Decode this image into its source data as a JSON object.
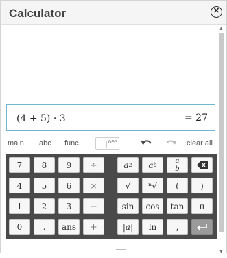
{
  "window": {
    "title": "Calculator",
    "close_symbol": "⊗"
  },
  "input": {
    "expression": "(4 + 5) · 3",
    "result": "= 27"
  },
  "toolbar": {
    "tabs": [
      "main",
      "abc",
      "func"
    ],
    "angle_mode": "DEG",
    "clear_label": "clear all"
  },
  "keypad": {
    "numeric": [
      [
        "7",
        "8",
        "9",
        "÷"
      ],
      [
        "4",
        "5",
        "6",
        "×"
      ],
      [
        "1",
        "2",
        "3",
        "−"
      ],
      [
        "0",
        ".",
        "ans",
        "+"
      ]
    ],
    "functions": [
      [
        "a²",
        "aᵇ",
        "a/b",
        "⌫"
      ],
      [
        "√",
        "ⁿ√",
        "(",
        ")"
      ],
      [
        "sin",
        "cos",
        "tan",
        "π"
      ],
      [
        "|a|",
        "ln",
        ",",
        "↵"
      ]
    ]
  },
  "colors": {
    "accent_border": "#6fb6d0",
    "keypad_bg": "#4a4a4a"
  }
}
